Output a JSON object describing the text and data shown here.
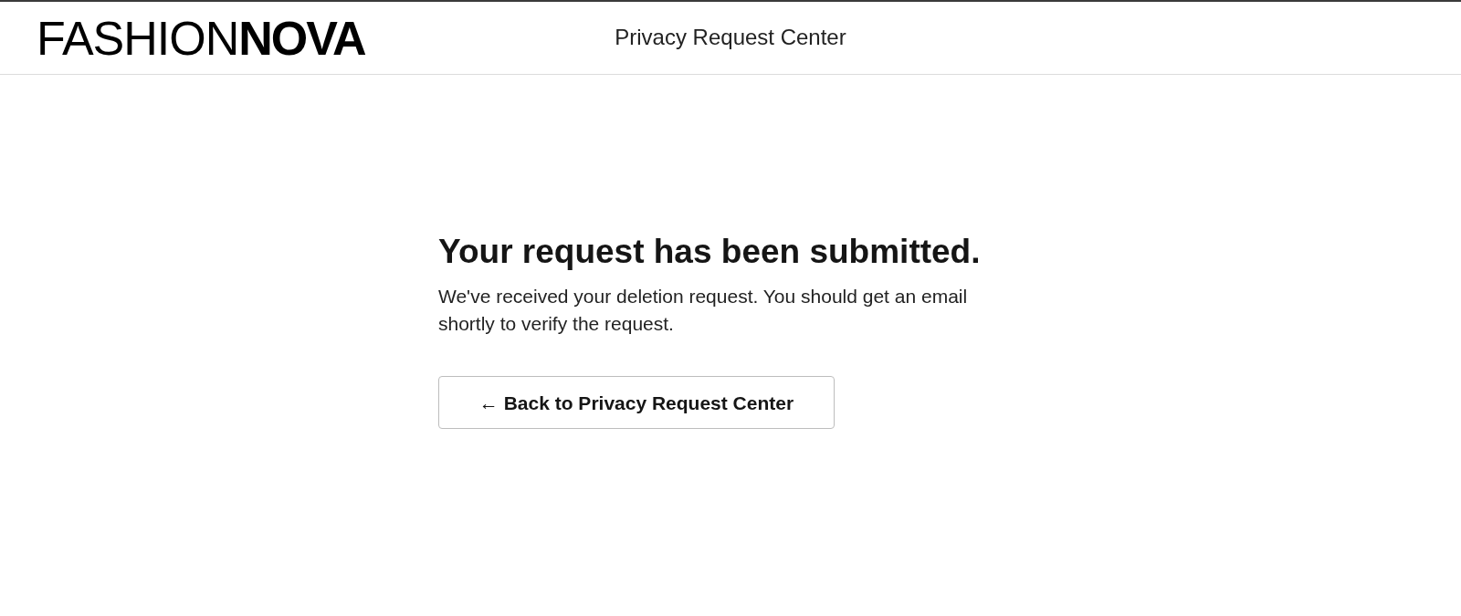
{
  "header": {
    "logo": "FASHION**NOVA**",
    "title": "Privacy Request Center"
  },
  "confirmation": {
    "heading": "Your request has been submitted.",
    "message": "We've received your deletion request. You should get an email shortly to verify the request.",
    "back_button": "← Back to Privacy Request Center"
  }
}
